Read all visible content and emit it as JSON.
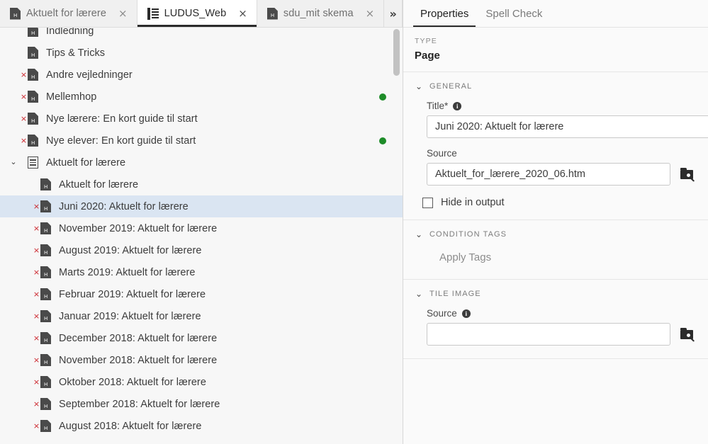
{
  "window": {
    "tabs": [
      {
        "label": "Aktuelt for lærere",
        "icon": "html-page-icon",
        "close": "×",
        "active": false
      },
      {
        "label": "LUDUS_Web",
        "icon": "project-book-icon",
        "close": "×",
        "active": true
      },
      {
        "label": "sdu_mit skema",
        "icon": "html-page-icon",
        "close": "×",
        "active": false
      }
    ],
    "overflow_label": "»"
  },
  "tree": {
    "items": [
      {
        "label": "Indledning",
        "level": 1,
        "icon": "html-page-icon",
        "broken": false,
        "selected": false,
        "status_dot": null,
        "chevron": ""
      },
      {
        "label": "Tips & Tricks",
        "level": 1,
        "icon": "html-page-icon",
        "broken": false,
        "selected": false,
        "status_dot": null,
        "chevron": ""
      },
      {
        "label": "Andre vejledninger",
        "level": 1,
        "icon": "html-page-icon",
        "broken": true,
        "selected": false,
        "status_dot": null,
        "chevron": ""
      },
      {
        "label": "Mellemhop",
        "level": 1,
        "icon": "html-page-icon",
        "broken": true,
        "selected": false,
        "status_dot": "#1d8c28",
        "chevron": ""
      },
      {
        "label": "Nye lærere: En kort guide til start",
        "level": 1,
        "icon": "html-page-icon",
        "broken": true,
        "selected": false,
        "status_dot": null,
        "chevron": ""
      },
      {
        "label": "Nye elever: En kort guide til start",
        "level": 1,
        "icon": "html-page-icon",
        "broken": true,
        "selected": false,
        "status_dot": "#1d8c28",
        "chevron": ""
      },
      {
        "label": "Aktuelt for lærere",
        "level": 0,
        "icon": "topic-folder-icon",
        "broken": false,
        "selected": false,
        "status_dot": null,
        "chevron": "⌄"
      },
      {
        "label": "Aktuelt for lærere",
        "level": 2,
        "icon": "html-page-icon",
        "broken": false,
        "selected": false,
        "status_dot": null,
        "chevron": ""
      },
      {
        "label": "Juni 2020: Aktuelt for lærere",
        "level": 2,
        "icon": "html-page-icon",
        "broken": true,
        "selected": true,
        "status_dot": null,
        "chevron": ""
      },
      {
        "label": "November 2019: Aktuelt for lærere",
        "level": 2,
        "icon": "html-page-icon",
        "broken": true,
        "selected": false,
        "status_dot": null,
        "chevron": ""
      },
      {
        "label": "August 2019: Aktuelt for lærere",
        "level": 2,
        "icon": "html-page-icon",
        "broken": true,
        "selected": false,
        "status_dot": null,
        "chevron": ""
      },
      {
        "label": "Marts 2019: Aktuelt for lærere",
        "level": 2,
        "icon": "html-page-icon",
        "broken": true,
        "selected": false,
        "status_dot": null,
        "chevron": ""
      },
      {
        "label": "Februar 2019: Aktuelt for lærere",
        "level": 2,
        "icon": "html-page-icon",
        "broken": true,
        "selected": false,
        "status_dot": null,
        "chevron": ""
      },
      {
        "label": "Januar 2019: Aktuelt for lærere",
        "level": 2,
        "icon": "html-page-icon",
        "broken": true,
        "selected": false,
        "status_dot": null,
        "chevron": ""
      },
      {
        "label": "December 2018: Aktuelt for lærere",
        "level": 2,
        "icon": "html-page-icon",
        "broken": true,
        "selected": false,
        "status_dot": null,
        "chevron": ""
      },
      {
        "label": "November 2018: Aktuelt for lærere",
        "level": 2,
        "icon": "html-page-icon",
        "broken": true,
        "selected": false,
        "status_dot": null,
        "chevron": ""
      },
      {
        "label": "Oktober 2018: Aktuelt for lærere",
        "level": 2,
        "icon": "html-page-icon",
        "broken": true,
        "selected": false,
        "status_dot": null,
        "chevron": ""
      },
      {
        "label": "September 2018: Aktuelt for lærere",
        "level": 2,
        "icon": "html-page-icon",
        "broken": true,
        "selected": false,
        "status_dot": null,
        "chevron": ""
      },
      {
        "label": "August 2018: Aktuelt for lærere",
        "level": 2,
        "icon": "html-page-icon",
        "broken": true,
        "selected": false,
        "status_dot": null,
        "chevron": ""
      }
    ],
    "icon_text": "H",
    "broken_mark": "×"
  },
  "properties": {
    "tabs": [
      {
        "label": "Properties",
        "active": true
      },
      {
        "label": "Spell Check",
        "active": false
      }
    ],
    "type": {
      "kicker": "TYPE",
      "value": "Page"
    },
    "general": {
      "title": "GENERAL",
      "chevron": "⌄",
      "title_field": {
        "label": "Title*",
        "info": "i",
        "value": "Juni 2020: Aktuelt for lærere",
        "placeholder": ""
      },
      "source_field": {
        "label": "Source",
        "value": "Aktuelt_for_lærere_2020_06.htm",
        "placeholder": "",
        "browse_icon": "browse-folder-icon"
      },
      "hide_in_output": {
        "label": "Hide in output",
        "checked": false
      }
    },
    "condition_tags": {
      "title": "CONDITION TAGS",
      "chevron": "⌄",
      "apply_tags_label": "Apply Tags"
    },
    "tile_image": {
      "title": "TILE IMAGE",
      "chevron": "⌄",
      "source_field": {
        "label": "Source",
        "info": "i",
        "value": "",
        "placeholder": "",
        "browse_icon": "browse-folder-icon"
      }
    }
  },
  "colors": {
    "selection": "#dae5f2",
    "status_green": "#1d8c28",
    "broken_red": "#cc2229",
    "accent_underline": "#2b2b2b"
  }
}
